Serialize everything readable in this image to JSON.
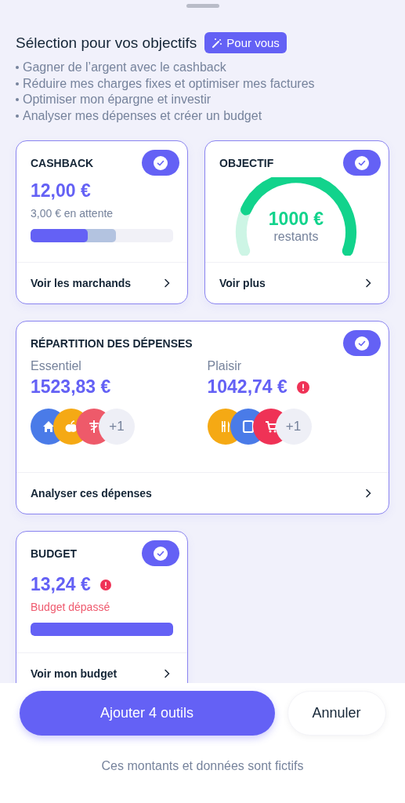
{
  "heading": {
    "title": "Sélection pour vos objectifs",
    "badge": "Pour vous"
  },
  "goals": [
    "Gagner de l’argent avec le cashback",
    "Réduire mes charges fixes et optimiser mes factures",
    "Optimiser mon épargne et investir",
    "Analyser mes dépenses et créer un budget"
  ],
  "cards": [
    {
      "kind": "cashback",
      "title": "CASHBACK",
      "selected": true,
      "amount": "12,00 €",
      "note": "3,00 € en attente",
      "segments": [
        {
          "kind": "earned",
          "level": 0.4
        },
        {
          "kind": "pending",
          "level": 0.6
        }
      ],
      "link": "Voir les marchands"
    },
    {
      "kind": "goal",
      "title": "OBJECTIF",
      "selected": true,
      "amount": "1000 €",
      "note": "restants",
      "link": "Voir plus"
    },
    {
      "kind": "split",
      "title": "RÉPARTITION DES DÉPENSES",
      "selected": true,
      "groups": [
        {
          "label": "Essentiel",
          "amount": "1523,83 €",
          "alert": false,
          "icons": [
            {
              "color": "#4a7be8"
            },
            {
              "color": "#f5a914"
            },
            {
              "color": "#ee5a6a"
            }
          ],
          "more": "+1"
        },
        {
          "label": "Plaisir",
          "amount": "1042,74 €",
          "alert": true,
          "icons": [
            {
              "color": "#f5a914"
            },
            {
              "color": "#4a7be8"
            },
            {
              "color": "#ef3256"
            }
          ],
          "more": "+1"
        }
      ],
      "link": "Analyser ces dépenses"
    },
    {
      "kind": "budget",
      "title": "BUDGET",
      "selected": true,
      "amount": "13,24 €",
      "alert": true,
      "note": "Budget dépassé",
      "level": 1,
      "link": "Voir mon budget"
    }
  ],
  "actions": {
    "primary": "Ajouter 4 outils",
    "secondary": "Annuler"
  },
  "disclaimer": "Ces montants et données sont fictifs"
}
